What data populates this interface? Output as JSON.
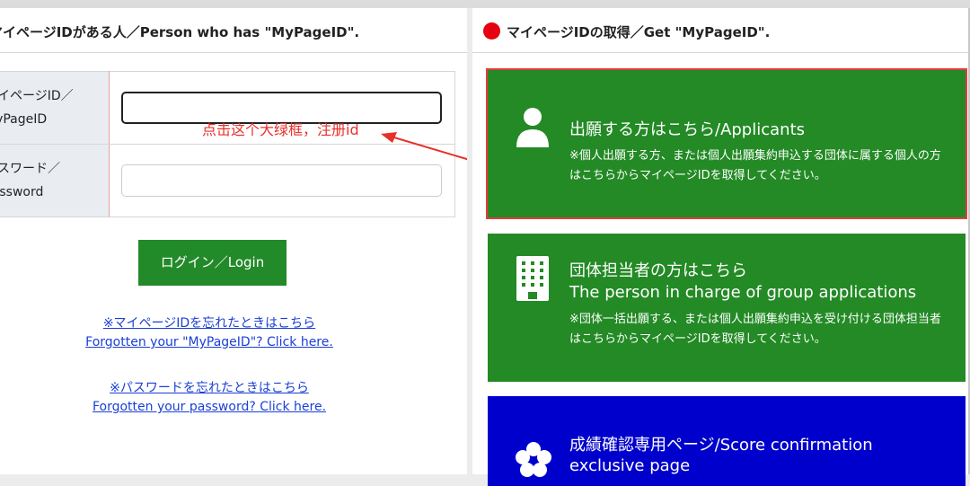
{
  "left": {
    "heading": "マイページIDがある人／Person who has \"MyPageID\".",
    "mypage_label": [
      "マイページID／",
      "MyPageID"
    ],
    "mypage_value": "",
    "password_label": [
      "パスワード／",
      "Password"
    ],
    "password_value": "",
    "annotation": "点击这个大绿框，注册id",
    "login_button": "ログイン／Login",
    "forgot_id_jp": "※マイページIDを忘れたときはこちら",
    "forgot_id_en": "Forgotten your \"MyPageID\"? Click here.",
    "forgot_pw_jp": "※パスワードを忘れたときはこちら",
    "forgot_pw_en": "Forgotten your password? Click here."
  },
  "right": {
    "heading": "マイページIDの取得／Get \"MyPageID\".",
    "cards": [
      {
        "title_lines": [
          "出願する方はこちら/Applicants"
        ],
        "note": "※個人出願する方、または個人出願集約申込する団体に属する個人の方はこちらからマイページIDを取得してください。",
        "icon": "person-icon",
        "color": "#238a25"
      },
      {
        "title_lines": [
          "団体担当者の方はこちら",
          "The person in charge of group applications"
        ],
        "note": "※団体一括出願する、または個人出願集約申込を受け付ける団体担当者はこちらからマイページIDを取得してください。",
        "icon": "building-icon",
        "color": "#238a25"
      },
      {
        "title_lines": [
          "成績確認専用ページ/Score confirmation",
          "exclusive page"
        ],
        "icon": "flower-icon",
        "color": "#0000cc"
      }
    ]
  },
  "colors": {
    "accent_green": "#238a25",
    "highlight_red": "#e63b3b",
    "annotation_red": "#e8302a",
    "link_blue": "#1a3fd6",
    "dot_red": "#e60012"
  }
}
